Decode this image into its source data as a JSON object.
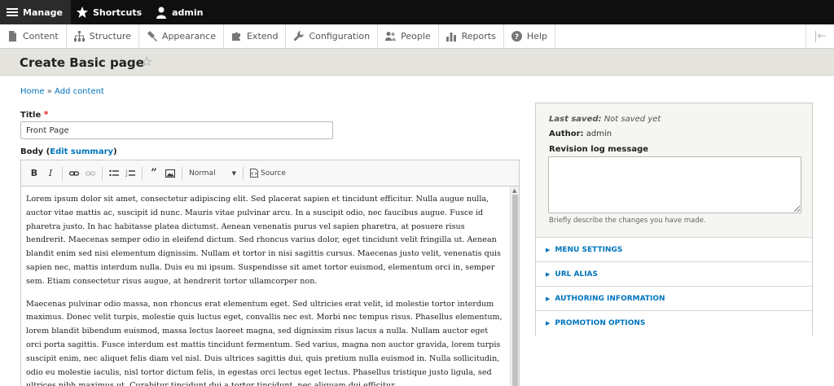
{
  "toolbar": {
    "manage": "Manage",
    "shortcuts": "Shortcuts",
    "user": "admin"
  },
  "tray": {
    "items": [
      {
        "label": "Content",
        "icon": "document-icon"
      },
      {
        "label": "Structure",
        "icon": "sitemap-icon"
      },
      {
        "label": "Appearance",
        "icon": "paintbrush-icon"
      },
      {
        "label": "Extend",
        "icon": "puzzle-icon"
      },
      {
        "label": "Configuration",
        "icon": "wrench-icon"
      },
      {
        "label": "People",
        "icon": "people-icon"
      },
      {
        "label": "Reports",
        "icon": "bar-chart-icon"
      },
      {
        "label": "Help",
        "icon": "help-icon"
      }
    ]
  },
  "page": {
    "title": "Create Basic page",
    "breadcrumb_home": "Home",
    "breadcrumb_sep": "»",
    "breadcrumb_add": "Add content"
  },
  "form": {
    "title_label": "Title",
    "title_required": "*",
    "title_value": "Front Page",
    "body_label": "Body",
    "edit_summary": "Edit summary",
    "format_value": "Normal",
    "source_label": "Source",
    "paragraphs": [
      "Lorem ipsum dolor sit amet, consectetur adipiscing elit. Sed placerat sapien et tincidunt efficitur. Nulla augue nulla, auctor vitae mattis ac, suscipit id nunc. Mauris vitae pulvinar arcu. In a suscipit odio, nec faucibus augue. Fusce id pharetra justo. In hac habitasse platea dictumst. Aenean venenatis purus vel sapien pharetra, at posuere risus hendrerit. Maecenas semper odio in eleifend dictum. Sed rhoncus varius dolor, eget tincidunt velit fringilla ut. Aenean blandit enim sed nisi elementum dignissim. Nullam et tortor in nisi sagittis cursus. Maecenas justo velit, venenatis quis sapien nec, mattis interdum nulla. Duis eu mi ipsum. Suspendisse sit amet tortor euismod, elementum orci in, semper sem. Etiam consectetur risus augue, at hendrerit tortor ullamcorper non.",
      "Maecenas pulvinar odio massa, non rhoncus erat elementum eget. Sed ultricies erat velit, id molestie tortor interdum maximus. Donec velit turpis, molestie quis luctus eget, convallis nec est. Morbi nec tempus risus. Phasellus elementum, lorem blandit bibendum euismod, massa lectus laoreet magna, sed dignissim risus lacus a nulla. Nullam auctor eget orci porta sagittis. Fusce interdum est mattis tincidunt fermentum. Sed varius, magna non auctor gravida, lorem turpis suscipit enim, nec aliquet felis diam vel nisl. Duis ultrices sagittis dui, quis pretium nulla euismod in. Nulla sollicitudin, odio eu molestie iaculis, nisl tortor dictum felis, in egestas orci lectus eget lectus. Phasellus tristique justo ligula, sed ultrices nibh maximus ut. Curabitur tincidunt dui a tortor tincidunt, nec aliquam dui efficitur."
    ]
  },
  "sidebar": {
    "last_saved_label": "Last saved:",
    "last_saved_value": "Not saved yet",
    "author_label": "Author:",
    "author_value": "admin",
    "revision_label": "Revision log message",
    "revision_desc": "Briefly describe the changes you have made.",
    "sections": [
      "MENU SETTINGS",
      "URL ALIAS",
      "AUTHORING INFORMATION",
      "PROMOTION OPTIONS"
    ]
  },
  "colors": {
    "link": "#0074bd",
    "toolbar_bg": "#0f0f0f",
    "header_bg": "#e4e3de"
  }
}
